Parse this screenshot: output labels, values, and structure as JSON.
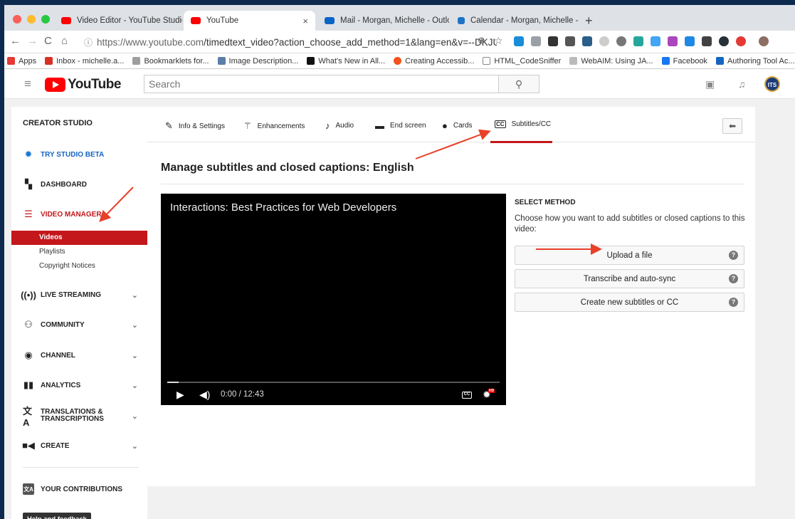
{
  "browser": {
    "tabs": [
      {
        "title": "Video Editor - YouTube Studio",
        "active": false
      },
      {
        "title": "YouTube",
        "active": true
      },
      {
        "title": "Mail - Morgan, Michelle - Outlo",
        "active": false
      },
      {
        "title": "Calendar - Morgan, Michelle -",
        "active": false
      }
    ],
    "url_host": "https://www.youtube.com",
    "url_path": "/timedtext_video?action_choose_add_method=1&lang=en&v=--DKJUm...",
    "bookmarks": [
      "Apps",
      "Inbox - michelle.a...",
      "Bookmarklets for...",
      "Image Description...",
      "What's New in All...",
      "Creating Accessib...",
      "HTML_CodeSniffer",
      "WebAIM: Using JA...",
      "Facebook",
      "Authoring Tool Ac..."
    ]
  },
  "masthead": {
    "logo": "YouTube",
    "search_placeholder": "Search"
  },
  "sidebar": {
    "title": "CREATOR STUDIO",
    "items": [
      {
        "label": "TRY STUDIO BETA",
        "icon": "gear-icon"
      },
      {
        "label": "DASHBOARD",
        "icon": "dashboard-icon"
      },
      {
        "label": "VIDEO MANAGER",
        "icon": "video-manager-icon"
      },
      {
        "label": "LIVE STREAMING",
        "icon": "live-icon"
      },
      {
        "label": "COMMUNITY",
        "icon": "community-icon"
      },
      {
        "label": "CHANNEL",
        "icon": "channel-icon"
      },
      {
        "label": "ANALYTICS",
        "icon": "analytics-icon"
      },
      {
        "label": "TRANSLATIONS &",
        "label2": "TRANSCRIPTIONS",
        "icon": "translate-icon"
      },
      {
        "label": "CREATE",
        "icon": "camera-icon"
      },
      {
        "label": "YOUR CONTRIBUTIONS",
        "icon": "contributions-icon"
      }
    ],
    "subitems": [
      "Videos",
      "Playlists",
      "Copyright Notices"
    ],
    "help": "Help and feedback"
  },
  "main": {
    "tabs": [
      "Info & Settings",
      "Enhancements",
      "Audio",
      "End screen",
      "Cards",
      "Subtitles/CC"
    ],
    "active_tab": "Subtitles/CC",
    "title": "Manage subtitles and closed captions: English",
    "video": {
      "title": "Interactions: Best Practices for Web Developers",
      "time": "0:00 / 12:43"
    },
    "method": {
      "heading": "SELECT METHOD",
      "description": "Choose how you want to add subtitles or closed captions to this video:",
      "options": [
        "Upload a file",
        "Transcribe and auto-sync",
        "Create new subtitles or CC"
      ]
    }
  },
  "colors": {
    "accent": "#c4171b",
    "annotation_arrow": "#e8402a",
    "background": "#0d2a4e"
  }
}
